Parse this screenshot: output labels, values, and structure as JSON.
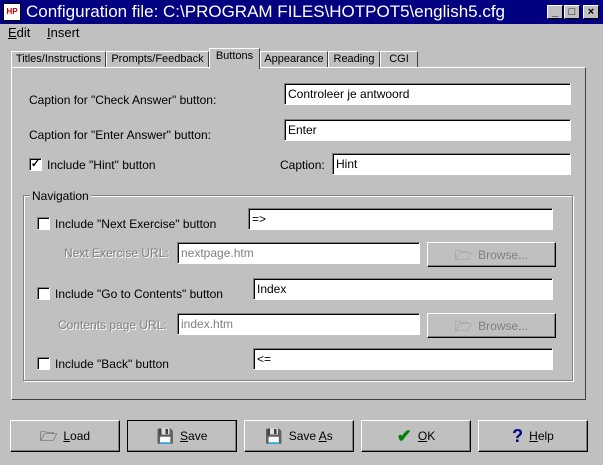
{
  "window": {
    "title": "Configuration file: C:\\PROGRAM FILES\\HOTPOT5\\english5.cfg",
    "app_icon_text": "HP"
  },
  "menu": {
    "edit_label": "Edit",
    "insert_label": "Insert"
  },
  "tabs": [
    {
      "label": "Titles/Instructions"
    },
    {
      "label": "Prompts/Feedback"
    },
    {
      "label": "Buttons",
      "active": true
    },
    {
      "label": "Appearance"
    },
    {
      "label": "Reading"
    },
    {
      "label": "CGI"
    }
  ],
  "buttons_tab": {
    "check_answer_label": "Caption for \"Check Answer\" button:",
    "check_answer_value": "Controleer je antwoord",
    "enter_answer_label": "Caption for \"Enter Answer\" button:",
    "enter_answer_value": "Enter",
    "hint_label": "Include \"Hint\" button",
    "hint_checked": true,
    "hint_caption_label": "Caption:",
    "hint_caption_value": "Hint",
    "navigation": {
      "legend": "Navigation",
      "next_exercise_label": "Include \"Next Exercise\" button",
      "next_exercise_checked": false,
      "next_exercise_value": "=>",
      "next_url_label": "Next Exercise URL:",
      "next_url_value": "nextpage.htm",
      "browse_label": "Browse...",
      "contents_label": "Include \"Go to Contents\" button",
      "contents_checked": false,
      "contents_value": "Index",
      "contents_url_label": "Contents page URL:",
      "contents_url_value": "index.htm",
      "back_label": "Include \"Back\" button",
      "back_checked": false,
      "back_value": "<="
    }
  },
  "footer": {
    "load_label": "Load",
    "save_label": "Save",
    "save_as_label": "Save As",
    "ok_label": "OK",
    "help_label": "Help"
  },
  "colors": {
    "titlebar": "#000080",
    "face": "#c0c0c0",
    "ok_check": "#008000",
    "help_mark": "#000080"
  }
}
